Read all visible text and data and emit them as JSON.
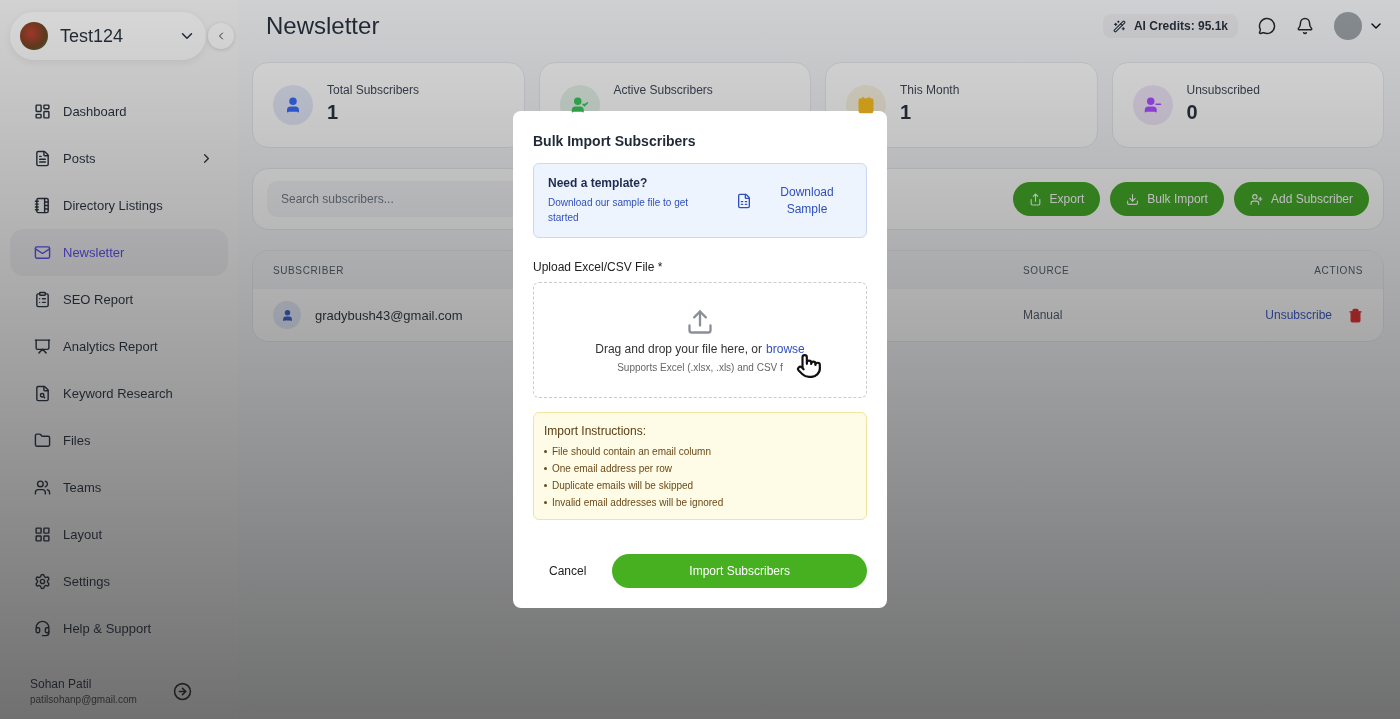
{
  "workspace": {
    "name": "Test124"
  },
  "sidebar": {
    "items": [
      {
        "label": "Dashboard",
        "kind": "link",
        "selected": false
      },
      {
        "label": "Posts",
        "kind": "group",
        "selected": false
      },
      {
        "label": "Directory Listings",
        "kind": "link",
        "selected": false
      },
      {
        "label": "Newsletter",
        "kind": "link",
        "selected": true
      },
      {
        "label": "SEO Report",
        "kind": "link",
        "selected": false
      },
      {
        "label": "Analytics Report",
        "kind": "link",
        "selected": false
      },
      {
        "label": "Keyword Research",
        "kind": "link",
        "selected": false
      },
      {
        "label": "Files",
        "kind": "link",
        "selected": false
      },
      {
        "label": "Teams",
        "kind": "link",
        "selected": false
      },
      {
        "label": "Layout",
        "kind": "link",
        "selected": false
      },
      {
        "label": "Settings",
        "kind": "link",
        "selected": false
      },
      {
        "label": "Help & Support",
        "kind": "link",
        "selected": false
      }
    ]
  },
  "user": {
    "name": "Sohan Patil",
    "email": "patilsohanp@gmail.com"
  },
  "header": {
    "title": "Newsletter",
    "credits": "AI Credits: 95.1k"
  },
  "stats": [
    {
      "label": "Total Subscribers",
      "value": "1",
      "color": "#2f56c9"
    },
    {
      "label": "Active Subscribers",
      "color": "#2f9e4a"
    },
    {
      "label": "This Month",
      "value": "1",
      "color": "#c99a1a"
    },
    {
      "label": "Unsubscribed",
      "value": "0",
      "color": "#8a3fd1"
    }
  ],
  "toolbar": {
    "search_placeholder": "Search subscribers...",
    "buttons": [
      "Export",
      "Bulk Import",
      "Add Subscriber"
    ]
  },
  "table": {
    "columns": [
      "SUBSCRIBER",
      "SOURCE",
      "ACTIONS"
    ],
    "rows": [
      {
        "email": "gradybush43@gmail.com",
        "source": "Manual",
        "action": "Unsubscribe"
      }
    ]
  },
  "dialog": {
    "title": "Bulk Import Subscribers",
    "template": {
      "heading": "Need a template?",
      "text": "Download our sample file to get started",
      "link": "Download Sample"
    },
    "upload_label": "Upload Excel/CSV File *",
    "drop_text": "Drag and drop your file here, or",
    "browse": "browse",
    "supports": "Supports Excel (.xlsx, .xls) and CSV f",
    "instructions_title": "Import Instructions:",
    "instructions": [
      "File should contain an email column",
      "One email address per row",
      "Duplicate emails will be skipped",
      "Invalid email addresses will be ignored"
    ],
    "cancel": "Cancel",
    "submit": "Import Subscribers"
  }
}
